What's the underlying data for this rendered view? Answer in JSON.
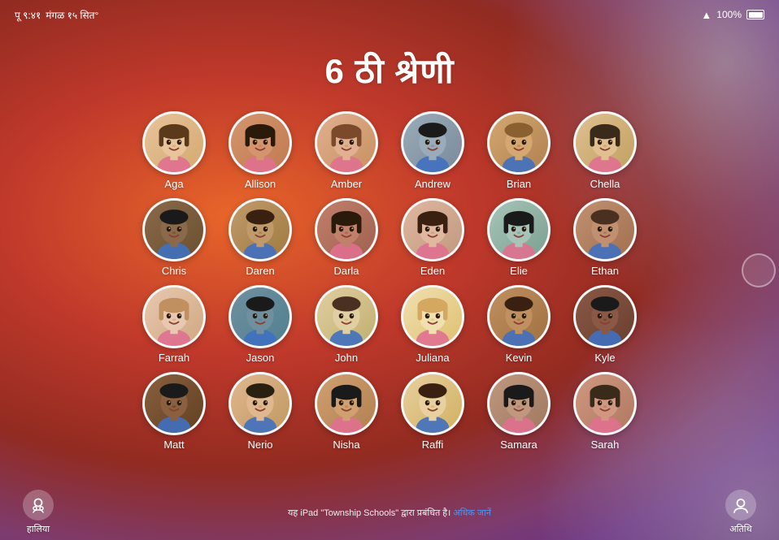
{
  "statusBar": {
    "time": "पू ९:४१",
    "date": "मंगळ १५ सित°",
    "wifi": "wifi",
    "battery": "100%"
  },
  "title": "6 ठी श्रेणी",
  "students": [
    {
      "id": 1,
      "name": "Aga",
      "avClass": "av-1",
      "emoji": "👧"
    },
    {
      "id": 2,
      "name": "Allison",
      "avClass": "av-2",
      "emoji": "👧"
    },
    {
      "id": 3,
      "name": "Amber",
      "avClass": "av-3",
      "emoji": "👧"
    },
    {
      "id": 4,
      "name": "Andrew",
      "avClass": "av-4",
      "emoji": "👦"
    },
    {
      "id": 5,
      "name": "Brian",
      "avClass": "av-5",
      "emoji": "👦"
    },
    {
      "id": 6,
      "name": "Chella",
      "avClass": "av-6",
      "emoji": "👧"
    },
    {
      "id": 7,
      "name": "Chris",
      "avClass": "av-7",
      "emoji": "👦"
    },
    {
      "id": 8,
      "name": "Daren",
      "avClass": "av-8",
      "emoji": "👦"
    },
    {
      "id": 9,
      "name": "Darla",
      "avClass": "av-9",
      "emoji": "👧"
    },
    {
      "id": 10,
      "name": "Eden",
      "avClass": "av-10",
      "emoji": "👧"
    },
    {
      "id": 11,
      "name": "Elie",
      "avClass": "av-11",
      "emoji": "👧"
    },
    {
      "id": 12,
      "name": "Ethan",
      "avClass": "av-12",
      "emoji": "👦"
    },
    {
      "id": 13,
      "name": "Farrah",
      "avClass": "av-13",
      "emoji": "👧"
    },
    {
      "id": 14,
      "name": "Jason",
      "avClass": "av-14",
      "emoji": "👦"
    },
    {
      "id": 15,
      "name": "John",
      "avClass": "av-15",
      "emoji": "👦"
    },
    {
      "id": 16,
      "name": "Juliana",
      "avClass": "av-16",
      "emoji": "👧"
    },
    {
      "id": 17,
      "name": "Kevin",
      "avClass": "av-17",
      "emoji": "👦"
    },
    {
      "id": 18,
      "name": "Kyle",
      "avClass": "av-18",
      "emoji": "👦"
    },
    {
      "id": 19,
      "name": "Matt",
      "avClass": "av-19",
      "emoji": "👦"
    },
    {
      "id": 20,
      "name": "Nerio",
      "avClass": "av-20",
      "emoji": "👦"
    },
    {
      "id": 21,
      "name": "Nisha",
      "avClass": "av-21",
      "emoji": "👧"
    },
    {
      "id": 22,
      "name": "Raffi",
      "avClass": "av-22",
      "emoji": "👦"
    },
    {
      "id": 23,
      "name": "Samara",
      "avClass": "av-2",
      "emoji": "👧"
    },
    {
      "id": 24,
      "name": "Sarah",
      "avClass": "av-9",
      "emoji": "👧"
    }
  ],
  "bottomBar": {
    "leftLabel": "हालिया",
    "rightLabel": "अतिथि",
    "infoText": "यह iPad \"Township Schools\" द्वारा प्रबंधित है।",
    "infoLink": "अधिक जानें"
  }
}
